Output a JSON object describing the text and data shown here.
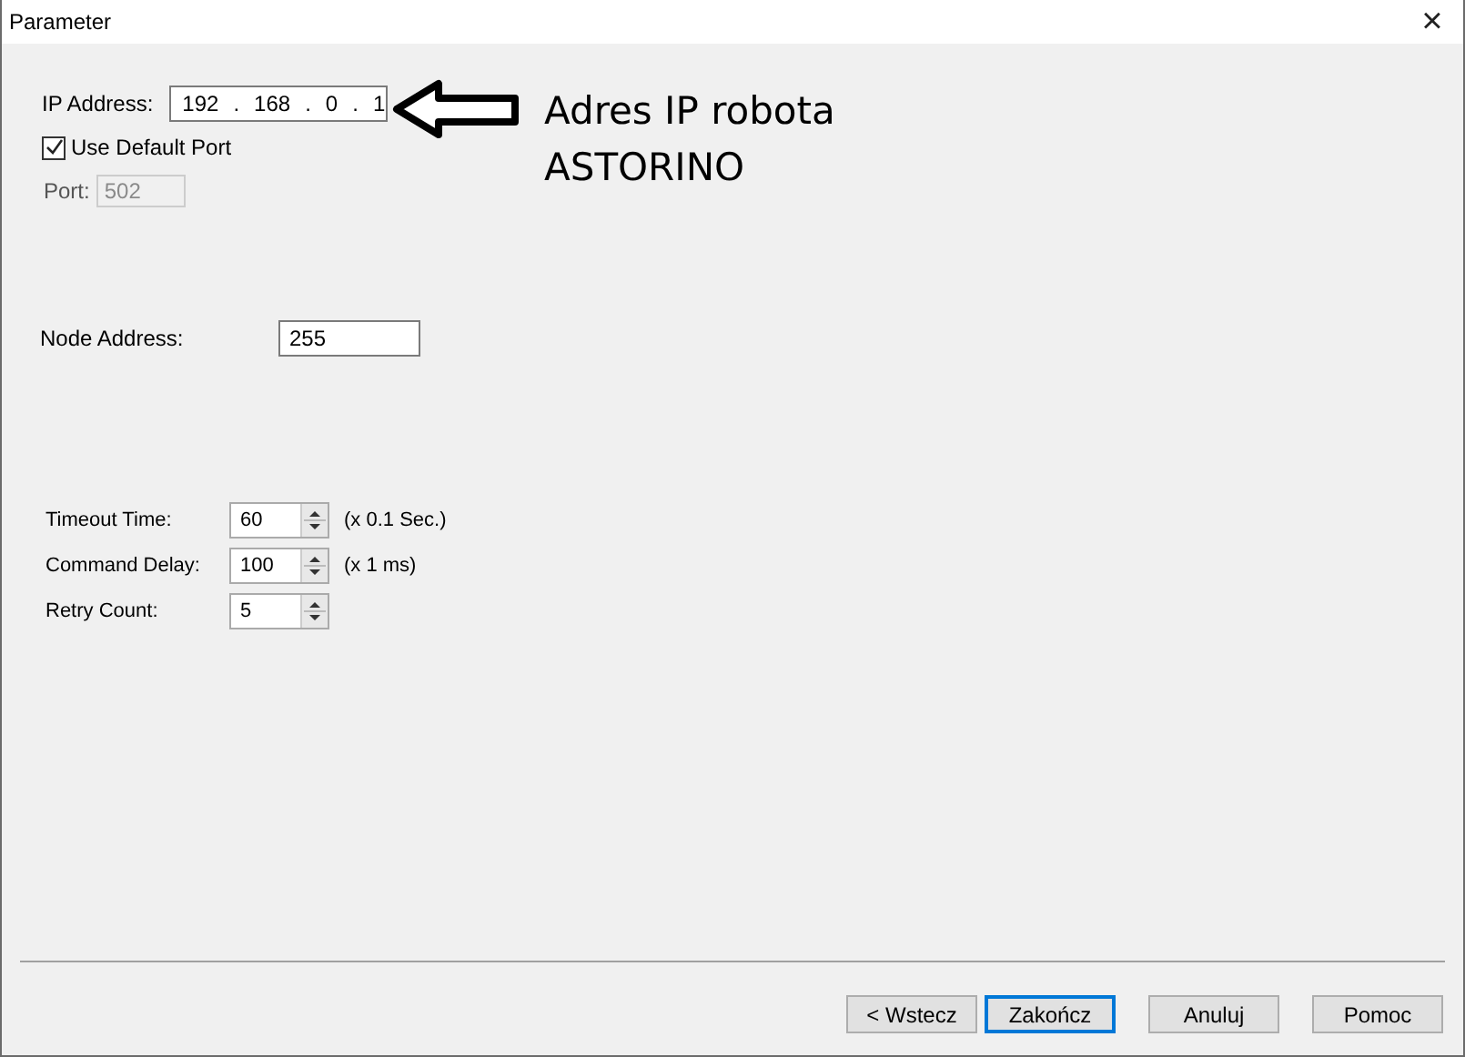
{
  "window": {
    "title": "Parameter",
    "close": "×"
  },
  "ip": {
    "label": "IP Address:",
    "segments": [
      "192",
      ".",
      "168",
      ".",
      "0",
      ".",
      "1"
    ]
  },
  "default_port": {
    "label": "Use Default Port",
    "checked": true
  },
  "port": {
    "label": "Port:",
    "value": "502",
    "disabled": true
  },
  "node": {
    "label": "Node Address:",
    "value": "255"
  },
  "spinners": [
    {
      "label": "Timeout Time:",
      "value": "60",
      "unit": "(x 0.1 Sec.)"
    },
    {
      "label": "Command Delay:",
      "value": "100",
      "unit": "(x 1 ms)"
    },
    {
      "label": "Retry Count:",
      "value": "5"
    }
  ],
  "annotation": {
    "lines": [
      "Adres IP robota",
      "ASTORINO"
    ]
  },
  "buttons": [
    {
      "label": "< Wstecz",
      "default": false
    },
    {
      "label": "Zakończ",
      "default": true
    },
    {
      "label": "Anuluj",
      "default": false
    },
    {
      "label": "Pomoc",
      "default": false
    }
  ]
}
